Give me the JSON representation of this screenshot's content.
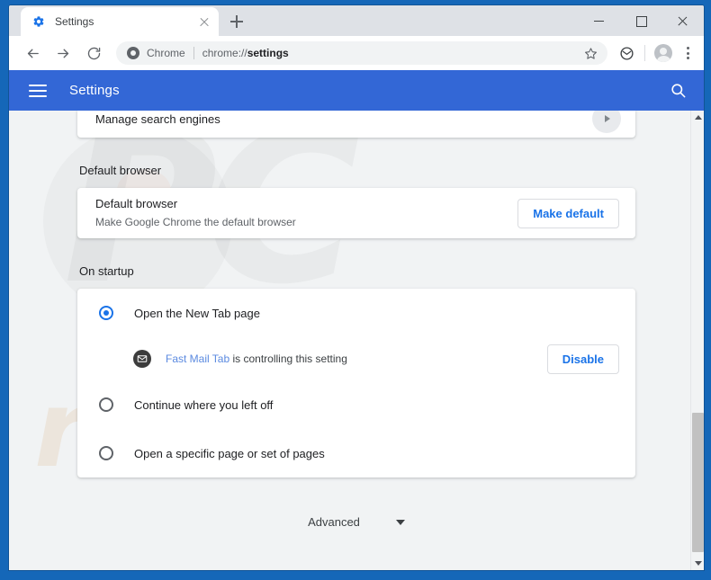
{
  "window": {
    "controls": {
      "minimize": "minimize-button",
      "maximize": "maximize-button",
      "close": "close-button"
    }
  },
  "tabstrip": {
    "tabs": [
      {
        "title": "Settings",
        "favicon": "settings-gear-icon",
        "active": true
      }
    ],
    "new_tab_label": "+"
  },
  "toolbar": {
    "back": "back-arrow-icon",
    "forward": "forward-arrow-icon",
    "reload": "reload-icon",
    "omnibox": {
      "security_label": "Chrome",
      "url_prefix": "chrome://",
      "url_bold": "settings",
      "full_url": "chrome://settings"
    },
    "bookmark": "star-icon",
    "extension": "extension-puzzle-icon",
    "profile": "avatar-icon",
    "menu": "three-dot-menu-icon"
  },
  "settings_header": {
    "menu_icon": "hamburger-icon",
    "title": "Settings",
    "search_icon": "search-icon"
  },
  "sections": {
    "search_engines": {
      "row_label": "Manage search engines",
      "arrow": "chevron-right-icon"
    },
    "default_browser": {
      "section_title": "Default browser",
      "primary": "Default browser",
      "secondary": "Make Google Chrome the default browser",
      "button": "Make default"
    },
    "on_startup": {
      "section_title": "On startup",
      "options": [
        {
          "label": "Open the New Tab page",
          "selected": true
        },
        {
          "label": "Continue where you left off",
          "selected": false
        },
        {
          "label": "Open a specific page or set of pages",
          "selected": false
        }
      ],
      "extension_notice": {
        "icon": "envelope-icon",
        "extension_name": "Fast Mail Tab",
        "suffix": " is controlling this setting",
        "button": "Disable"
      }
    },
    "advanced": {
      "label": "Advanced",
      "caret": "chevron-down-icon"
    }
  },
  "watermarks": {
    "logo": "PC",
    "domain": "risk.com"
  },
  "colors": {
    "settings_header_blue": "#3367d6",
    "accent_blue": "#1a73e8",
    "window_frame_blue": "#1567b8",
    "page_background": "#f1f3f4",
    "card_white": "#ffffff",
    "text_primary": "#202124",
    "text_secondary": "#5f6368"
  }
}
